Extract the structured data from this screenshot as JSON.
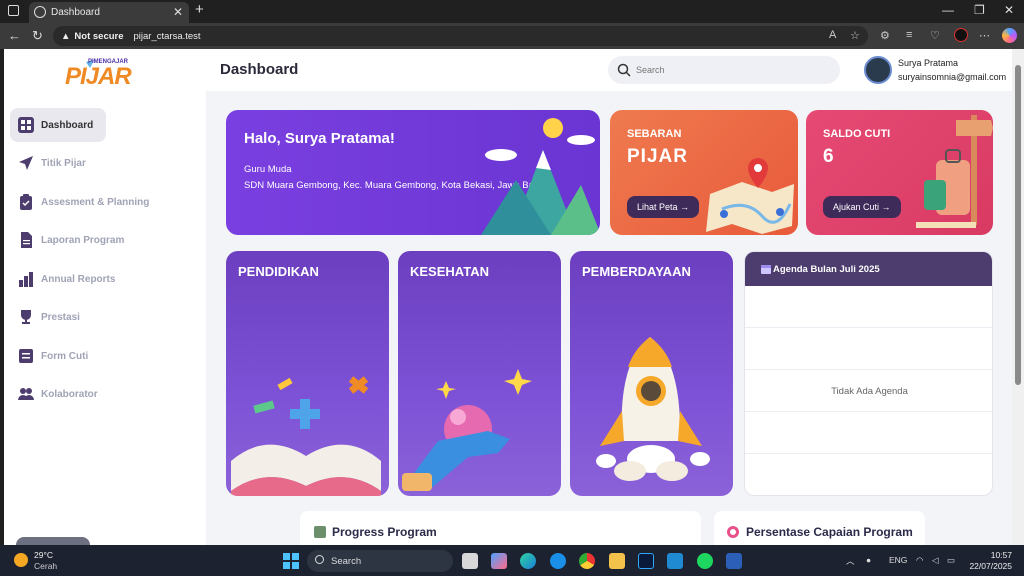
{
  "browser": {
    "tab_title": "Dashboard",
    "security_label": "Not secure",
    "url": "pijar_ctarsa.test"
  },
  "app": {
    "logo_main": "PIJAR",
    "logo_tag": "PIMENGAJAR",
    "page_title": "Dashboard",
    "search_placeholder": "Search",
    "user_name": "Surya Pratama",
    "user_email": "suryainsomnia@gmail.com"
  },
  "sidebar": {
    "items": [
      {
        "label": "Dashboard",
        "icon": "grid-icon",
        "active": true
      },
      {
        "label": "Titik Pijar",
        "icon": "send-icon"
      },
      {
        "label": "Assesment & Planning",
        "icon": "clipboard-icon"
      },
      {
        "label": "Laporan Program",
        "icon": "document-icon"
      },
      {
        "label": "Annual Reports",
        "icon": "bar-chart-icon"
      },
      {
        "label": "Prestasi",
        "icon": "trophy-icon"
      },
      {
        "label": "Form Cuti",
        "icon": "form-icon"
      },
      {
        "label": "Kolaborator",
        "icon": "users-icon"
      }
    ]
  },
  "welcome": {
    "greeting": "Halo, Surya Pratama!",
    "role": "Guru Muda",
    "school": "SDN Muara Gembong, Kec. Muara Gembong, Kota Bekasi, Jawa Barat"
  },
  "sebaran": {
    "title": "SEBARAN",
    "value": "PIJAR",
    "button": "Lihat Peta →"
  },
  "saldo": {
    "title": "SALDO CUTI",
    "value": "6",
    "button": "Ajukan Cuti →"
  },
  "programs": [
    {
      "label": "PENDIDIKAN"
    },
    {
      "label": "KESEHATAN"
    },
    {
      "label": "PEMBERDAYAAN"
    }
  ],
  "agenda": {
    "title": "Agenda Bulan Juli 2025",
    "empty": "Tidak Ada Agenda"
  },
  "sections": {
    "progress": "Progress Program",
    "persentase": "Persentase Capaian Program"
  },
  "taskbar": {
    "temperature": "29°C",
    "weather": "Cerah",
    "search": "Search",
    "lang": "ENG",
    "time": "10:57",
    "date": "22/07/2025"
  }
}
